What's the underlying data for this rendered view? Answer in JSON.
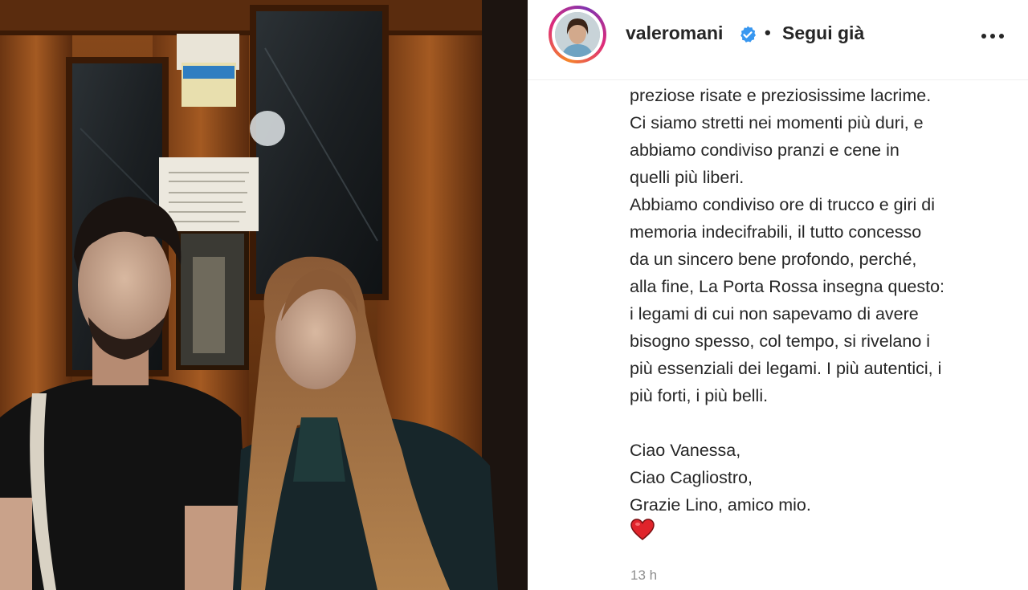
{
  "post": {
    "username": "valeromani",
    "separator": "•",
    "follow_label": "Segui già",
    "more_icon": "more-horizontal-icon",
    "verified_icon": "verified-badge-icon",
    "caption_lines": [
      "preziose risate e preziosissime lacrime.",
      "Ci siamo stretti nei momenti più duri, e",
      "abbiamo condiviso pranzi e cene in",
      "quelli più liberi.",
      "Abbiamo condiviso ore di trucco e giri di",
      "memoria indecifrabili, il tutto concesso",
      "da un sincero bene profondo, perché,",
      "alla fine, La Porta Rossa insegna questo:",
      "i legami di cui non sapevamo di avere",
      "bisogno spesso, col tempo, si rivelano i",
      "più essenziali dei legami. I più autentici, i",
      "più forti, i più belli."
    ],
    "closing_lines": [
      "Ciao Vanessa,",
      "Ciao Cagliostro,",
      "Grazie Lino, amico mio."
    ],
    "emoji": "red-heart-icon",
    "timestamp": "13 h"
  },
  "colors": {
    "text": "#262626",
    "muted": "#8e8e8e",
    "verified": "#3897f0",
    "heart": "#e0242b"
  }
}
